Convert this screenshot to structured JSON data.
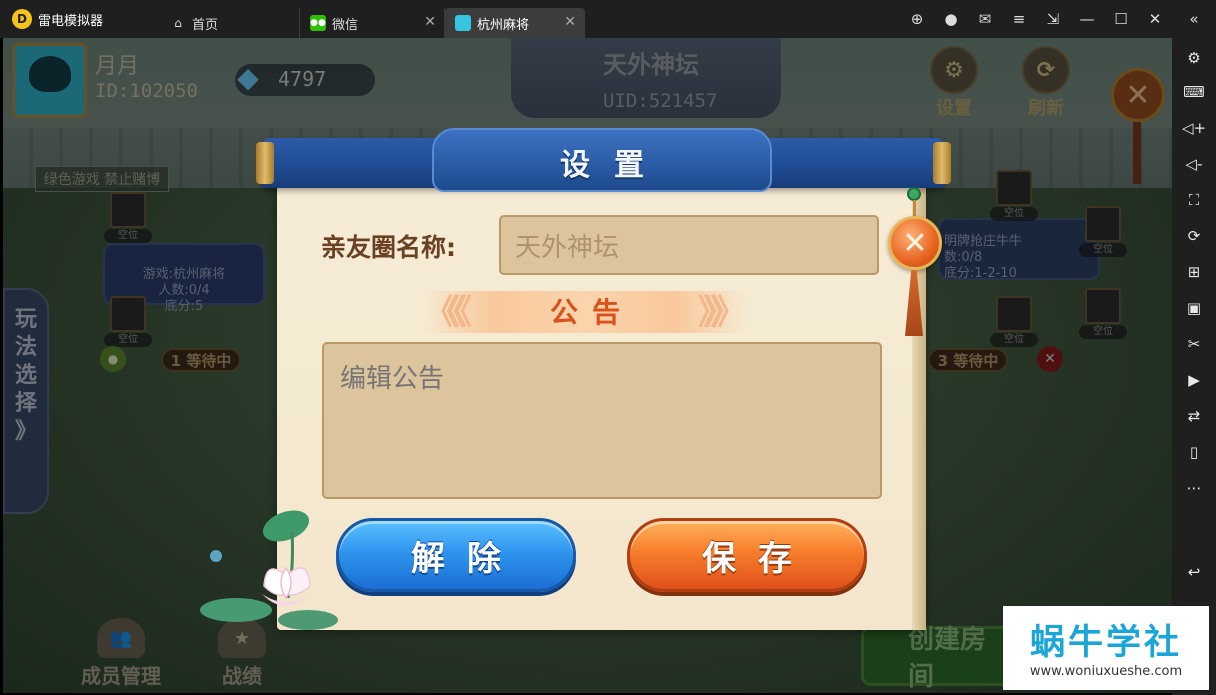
{
  "emulator": {
    "app_name": "雷电模拟器",
    "tabs": [
      {
        "label": "首页"
      },
      {
        "label": "微信"
      },
      {
        "label": "杭州麻将"
      }
    ]
  },
  "game": {
    "user": {
      "name": "月月",
      "id": "ID:102050",
      "diamonds": "4797"
    },
    "room": {
      "name": "天外神坛",
      "uid": "UID:521457"
    },
    "top_buttons": {
      "settings": "设置",
      "refresh": "刷新"
    },
    "rule_banner": "绿色游戏 禁止赌博",
    "side_tab": "玩法选择",
    "side_tab_arrow": "》",
    "tables": [
      {
        "line1": "游戏:杭州麻将",
        "line2": "人数:0/4",
        "line3": "底分:5",
        "waiting": "1 等待中"
      },
      {
        "line1": "明牌抢庄牛牛",
        "line2": "数:0/8",
        "line3": "底分:1-2-10",
        "waiting": "3 等待中"
      }
    ],
    "seat_label": "空位",
    "bottom": {
      "members": "成员管理",
      "records": "战绩",
      "create": "创建房间"
    }
  },
  "dialog": {
    "title": "设置",
    "name_label": "亲友圈名称:",
    "name_value": "天外神坛",
    "notice_title": "公告",
    "notice_placeholder": "编辑公告",
    "dismiss_label": "解除",
    "save_label": "保存"
  },
  "watermark": {
    "title": "蜗牛学社",
    "url": "www.woniuxueshe.com"
  }
}
